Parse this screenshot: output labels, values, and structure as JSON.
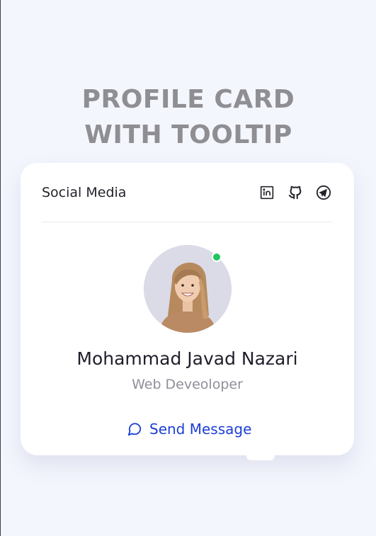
{
  "page": {
    "title": "PROFILE CARD WITH TOOLTIP"
  },
  "card": {
    "header_label": "Social Media",
    "socials": [
      {
        "icon": "linkedin-icon"
      },
      {
        "icon": "github-icon"
      },
      {
        "icon": "telegram-icon"
      }
    ],
    "profile": {
      "name": "Mohammad Javad Nazari",
      "role": "Web Deveoloper",
      "status": "online"
    },
    "action": {
      "icon": "chat-bubble-icon",
      "label": "Send Message"
    }
  },
  "colors": {
    "background": "#f4f6fd",
    "accent": "#1c3fd6",
    "status_online": "#22c55e",
    "title": "#8e8e93"
  }
}
